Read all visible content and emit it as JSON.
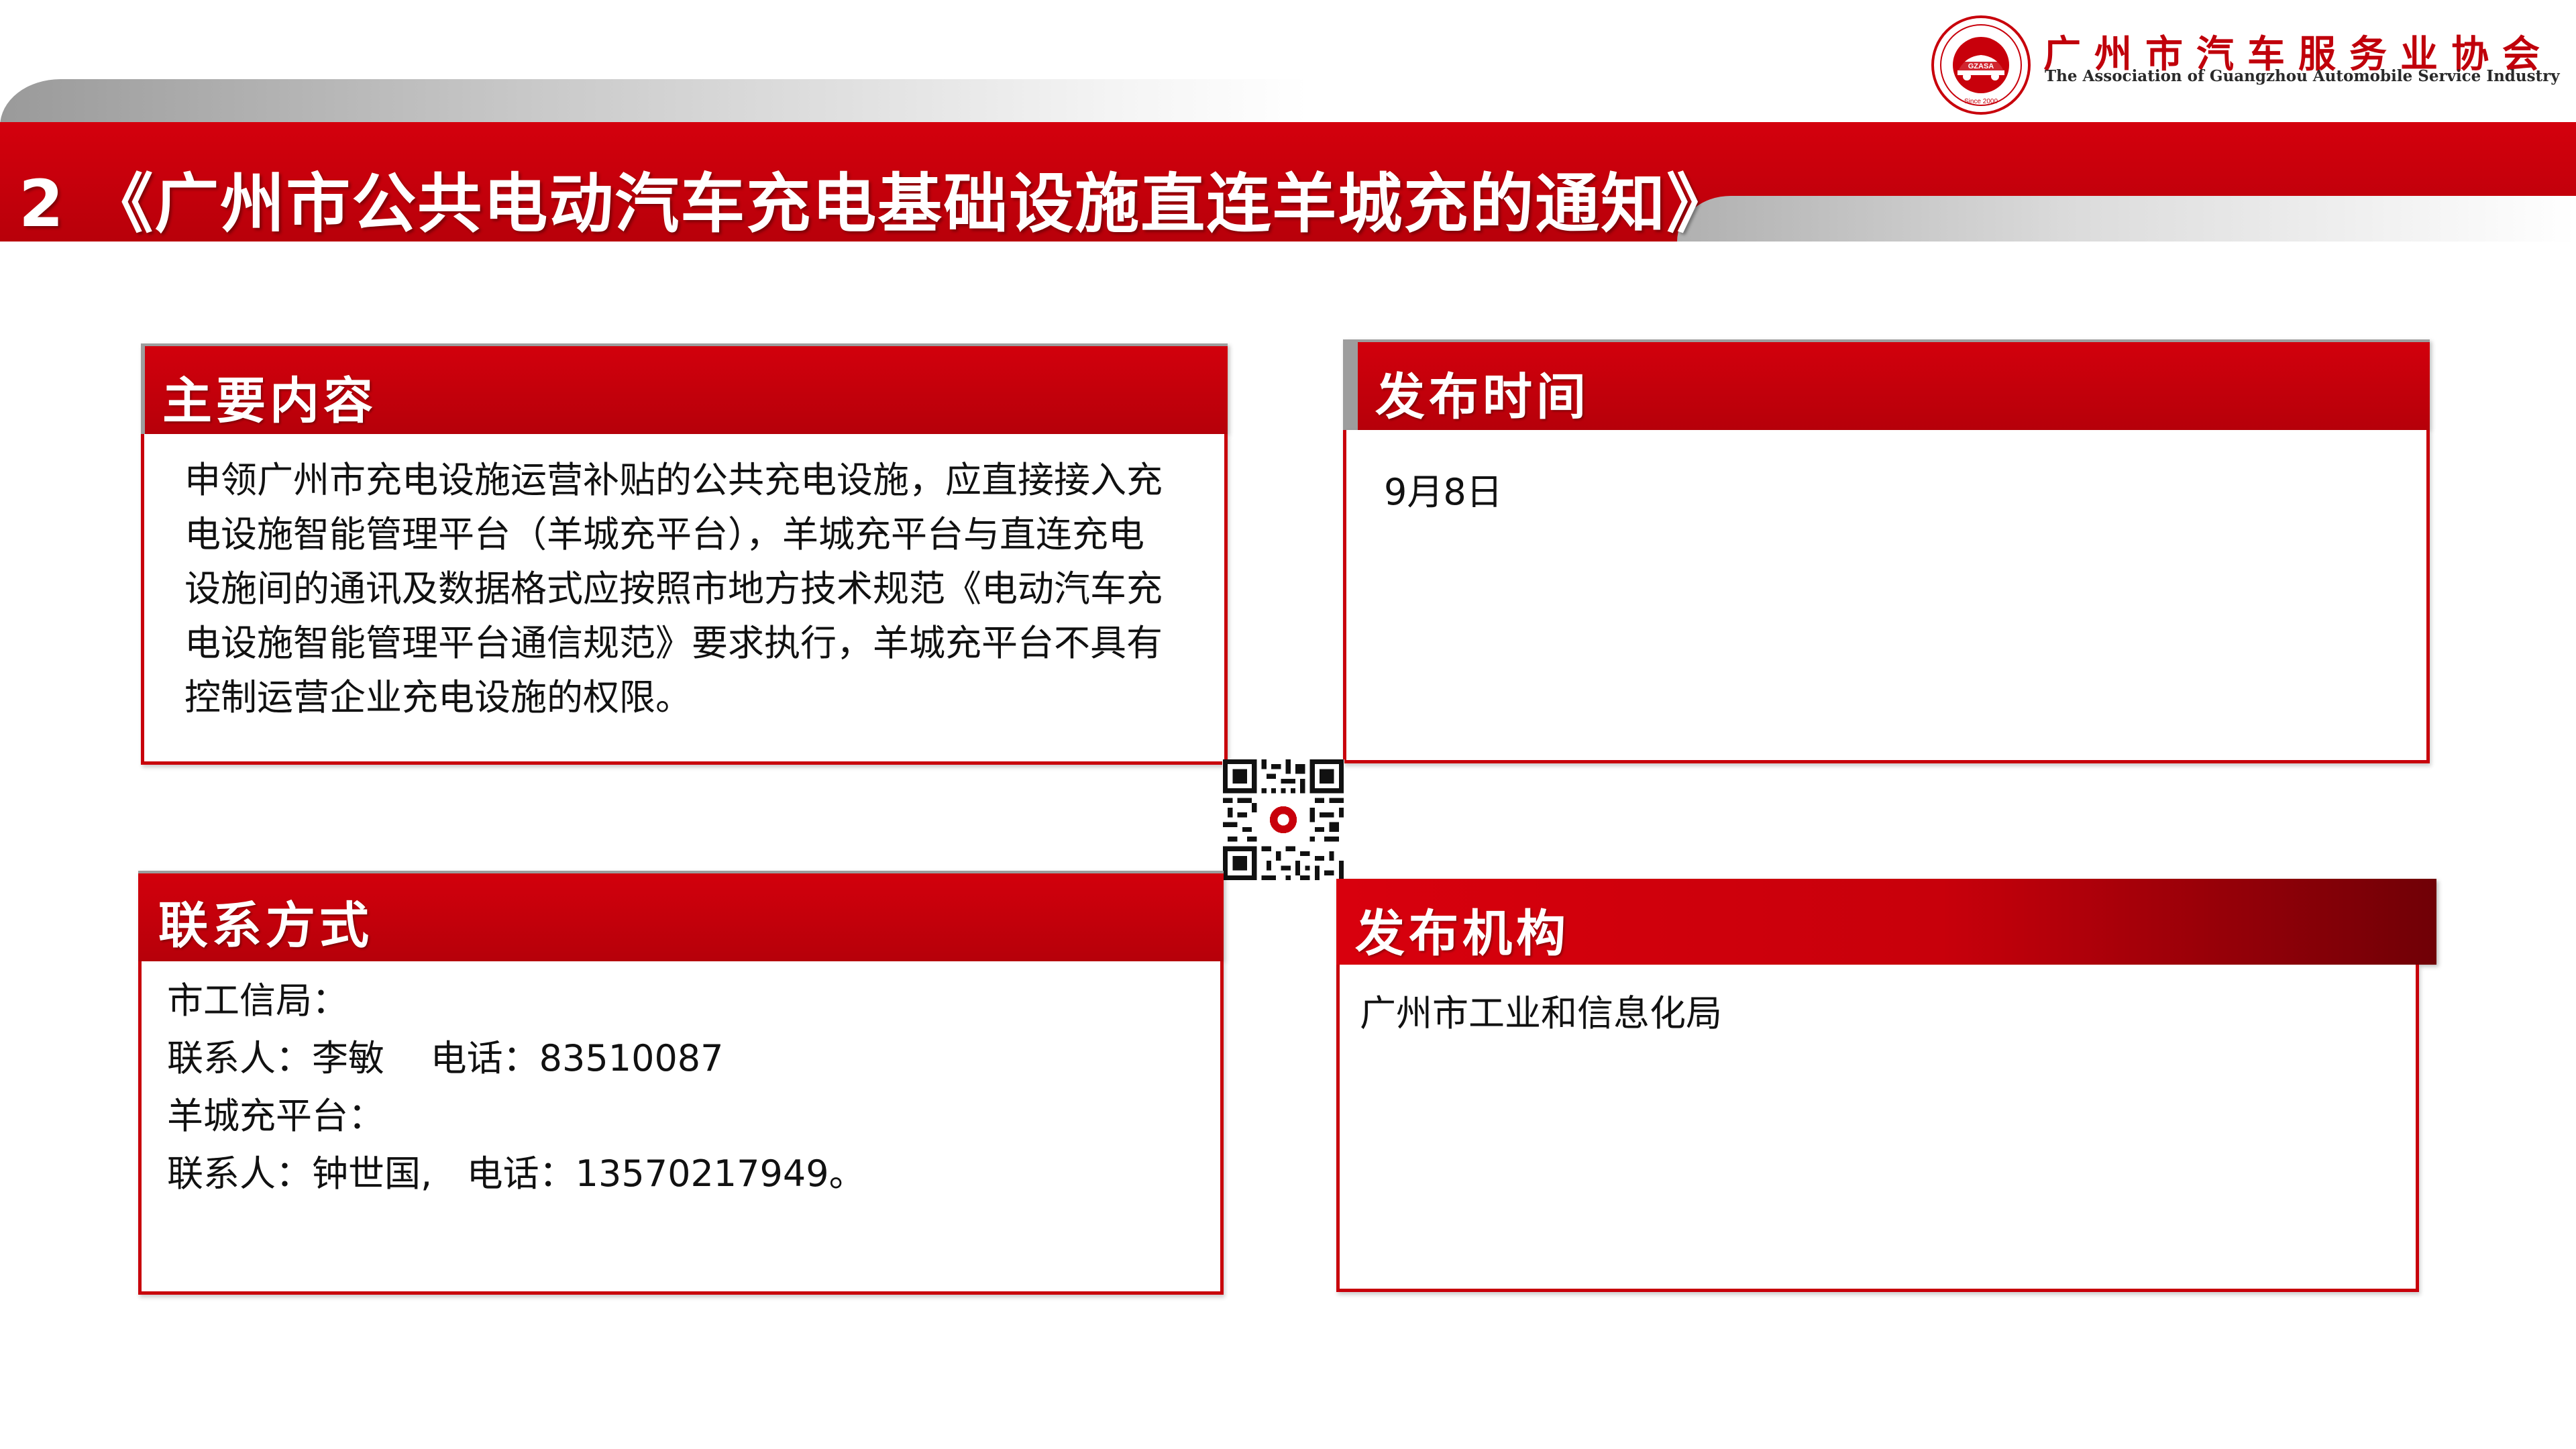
{
  "header": {
    "title": "2 《广州市公共电动汽车充电基础设施直连羊城充的通知》",
    "org_name_cn": "广州市汽车服务业协会",
    "org_name_en": "The Association of Guangzhou Automobile Service Industry",
    "logo_icon": "gzasa-seal-icon"
  },
  "panels": {
    "content": {
      "title": "主要内容",
      "lines": [
        "申领广州市充电设施运营补贴的公共充电设施，应直接接入充",
        "电设施智能管理平台（羊城充平台），羊城充平台与直连充电",
        "设施间的通讯及数据格式应按照市地方技术规范《电动汽车充",
        "电设施智能管理平台通信规范》要求执行，羊城充平台不具有",
        "控制运营企业充电设施的权限。"
      ]
    },
    "time": {
      "title": "发布时间",
      "value": "9月8日"
    },
    "contact": {
      "title": "联系方式",
      "lines": [
        "市工信局：",
        "联系人：李敏    电话：83510087",
        "羊城充平台：",
        "联系人：钟世国,   电话：13570217949。"
      ]
    },
    "org": {
      "title": "发布机构",
      "value": "广州市工业和信息化局"
    }
  },
  "qr_icon": "qr-code-icon",
  "colors": {
    "brand_red": "#c8000b",
    "gray": "#9d9d9d"
  }
}
